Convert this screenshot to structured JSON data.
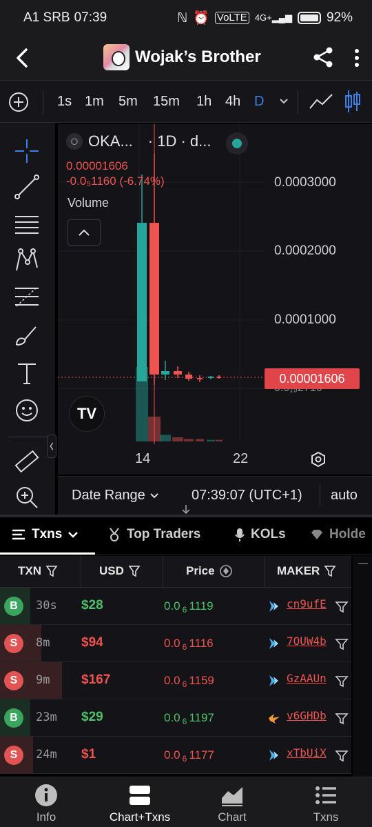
{
  "status": {
    "carrier": "A1 SRB",
    "time": "07:39",
    "battery": "92%",
    "volte": "VoLTE",
    "net": "4G+"
  },
  "header": {
    "title": "Wojak’s Brother"
  },
  "timeframes": {
    "items": [
      "1s",
      "1m",
      "5m",
      "15m",
      "1h",
      "4h",
      "D"
    ],
    "active": "D"
  },
  "chart": {
    "legend_symbol": "OKA...",
    "legend_interval": "· 1D · d...",
    "legend_badge": "O",
    "price": "0.00001606",
    "change": "-0.0₅1160 (-6.74%)",
    "volume_label": "Volume",
    "y_labels": [
      "0.0003000",
      "0.0002000",
      "0.0001000"
    ],
    "last_price_tag": "0.00001606",
    "partial_label": "0.0₁₉2716",
    "x_labels": [
      "14",
      "22"
    ],
    "tv_logo": "TV"
  },
  "chart_data": {
    "type": "candlestick",
    "y_ticks": [
      0.0003,
      0.0002,
      0.0001
    ],
    "last_price": 1.606e-05,
    "candles": [
      {
        "o": 1e-05,
        "h": 0.00031,
        "l": 1e-05,
        "c": 0.00024,
        "dir": "up"
      },
      {
        "o": 0.00024,
        "h": 0.00034,
        "l": 5e-06,
        "c": 2e-05,
        "dir": "down"
      },
      {
        "o": 2e-05,
        "h": 4e-05,
        "l": 1.2e-05,
        "c": 2.5e-05,
        "dir": "up"
      },
      {
        "o": 2.5e-05,
        "h": 3.2e-05,
        "l": 1.5e-05,
        "c": 2e-05,
        "dir": "down"
      },
      {
        "o": 2e-05,
        "h": 2.4e-05,
        "l": 1.1e-05,
        "c": 1.4e-05,
        "dir": "down"
      },
      {
        "o": 1.4e-05,
        "h": 1.9e-05,
        "l": 9e-06,
        "c": 1.5e-05,
        "dir": "down"
      },
      {
        "o": 1.5e-05,
        "h": 1.8e-05,
        "l": 1.3e-05,
        "c": 1.7e-05,
        "dir": "up"
      },
      {
        "o": 1.7e-05,
        "h": 1.9e-05,
        "l": 1.4e-05,
        "c": 1.6e-05,
        "dir": "down"
      }
    ],
    "volumes": [
      0.9,
      0.3,
      0.08,
      0.05,
      0.03,
      0.03,
      0.02,
      0.02
    ]
  },
  "range": {
    "label": "Date Range",
    "time": "07:39:07 (UTC+1)",
    "scale": "auto"
  },
  "tabs": [
    {
      "label": "Txns",
      "active": true
    },
    {
      "label": "Top Traders",
      "active": false
    },
    {
      "label": "KOLs",
      "active": false
    },
    {
      "label": "Holde",
      "active": false
    }
  ],
  "table": {
    "headers": [
      "TXN",
      "USD",
      "Price",
      "MAKER"
    ],
    "rows": [
      {
        "type": "B",
        "age": "30s",
        "usd": "$28",
        "price_a": "0.0",
        "price_sub": "6",
        "price_b": "1119",
        "maker": "cn9ufE",
        "side": "buy",
        "maker_icon": "blue"
      },
      {
        "type": "S",
        "age": "8m",
        "usd": "$94",
        "price_a": "0.0",
        "price_sub": "6",
        "price_b": "1116",
        "maker": "7QUW4b",
        "side": "sell",
        "maker_icon": "blue"
      },
      {
        "type": "S",
        "age": "9m",
        "usd": "$167",
        "price_a": "0.0",
        "price_sub": "6",
        "price_b": "1159",
        "maker": "GzAAUn",
        "side": "sell",
        "maker_icon": "blue"
      },
      {
        "type": "B",
        "age": "23m",
        "usd": "$29",
        "price_a": "0.0",
        "price_sub": "6",
        "price_b": "1197",
        "maker": "v6GHDb",
        "side": "buy",
        "maker_icon": "orange"
      },
      {
        "type": "S",
        "age": "24m",
        "usd": "$1",
        "price_a": "0.0",
        "price_sub": "6",
        "price_b": "1177",
        "maker": "xTbUiX",
        "side": "sell",
        "maker_icon": "blue"
      }
    ]
  },
  "nav": [
    {
      "label": "Info",
      "active": false
    },
    {
      "label": "Chart+Txns",
      "active": true
    },
    {
      "label": "Chart",
      "active": false
    },
    {
      "label": "Txns",
      "active": false
    }
  ],
  "colors": {
    "up": "#26a69a",
    "down": "#ef5350",
    "accent": "#3b7fe8",
    "buy": "#4cc36a"
  }
}
